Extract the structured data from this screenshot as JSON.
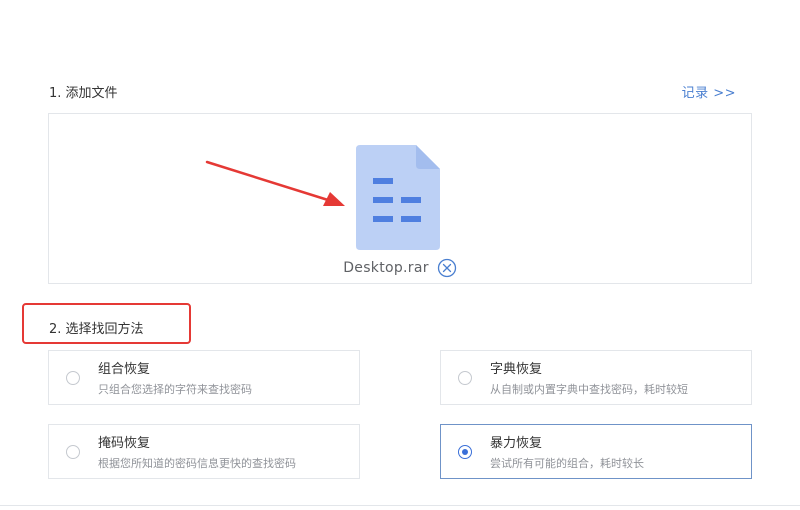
{
  "step1": {
    "title": "1. 添加文件",
    "records_link": "记录 >>"
  },
  "file": {
    "name": "Desktop.rar",
    "icon": "document-icon",
    "remove_icon": "close-circle-icon"
  },
  "step2": {
    "title": "2. 选择找回方法"
  },
  "methods": [
    {
      "id": "combo",
      "title": "组合恢复",
      "desc": "只组合您选择的字符来查找密码",
      "selected": false
    },
    {
      "id": "dict",
      "title": "字典恢复",
      "desc": "从自制或内置字典中查找密码，耗时较短",
      "selected": false
    },
    {
      "id": "mask",
      "title": "掩码恢复",
      "desc": "根据您所知道的密码信息更快的查找密码",
      "selected": false
    },
    {
      "id": "brute",
      "title": "暴力恢复",
      "desc": "尝试所有可能的组合，耗时较长",
      "selected": true
    }
  ],
  "colors": {
    "accent": "#3a6fd8",
    "link": "#4a7fd0",
    "file_icon": "#bcd0f5",
    "file_icon_lines": "#4f7fe0",
    "annotation": "#e53935"
  }
}
